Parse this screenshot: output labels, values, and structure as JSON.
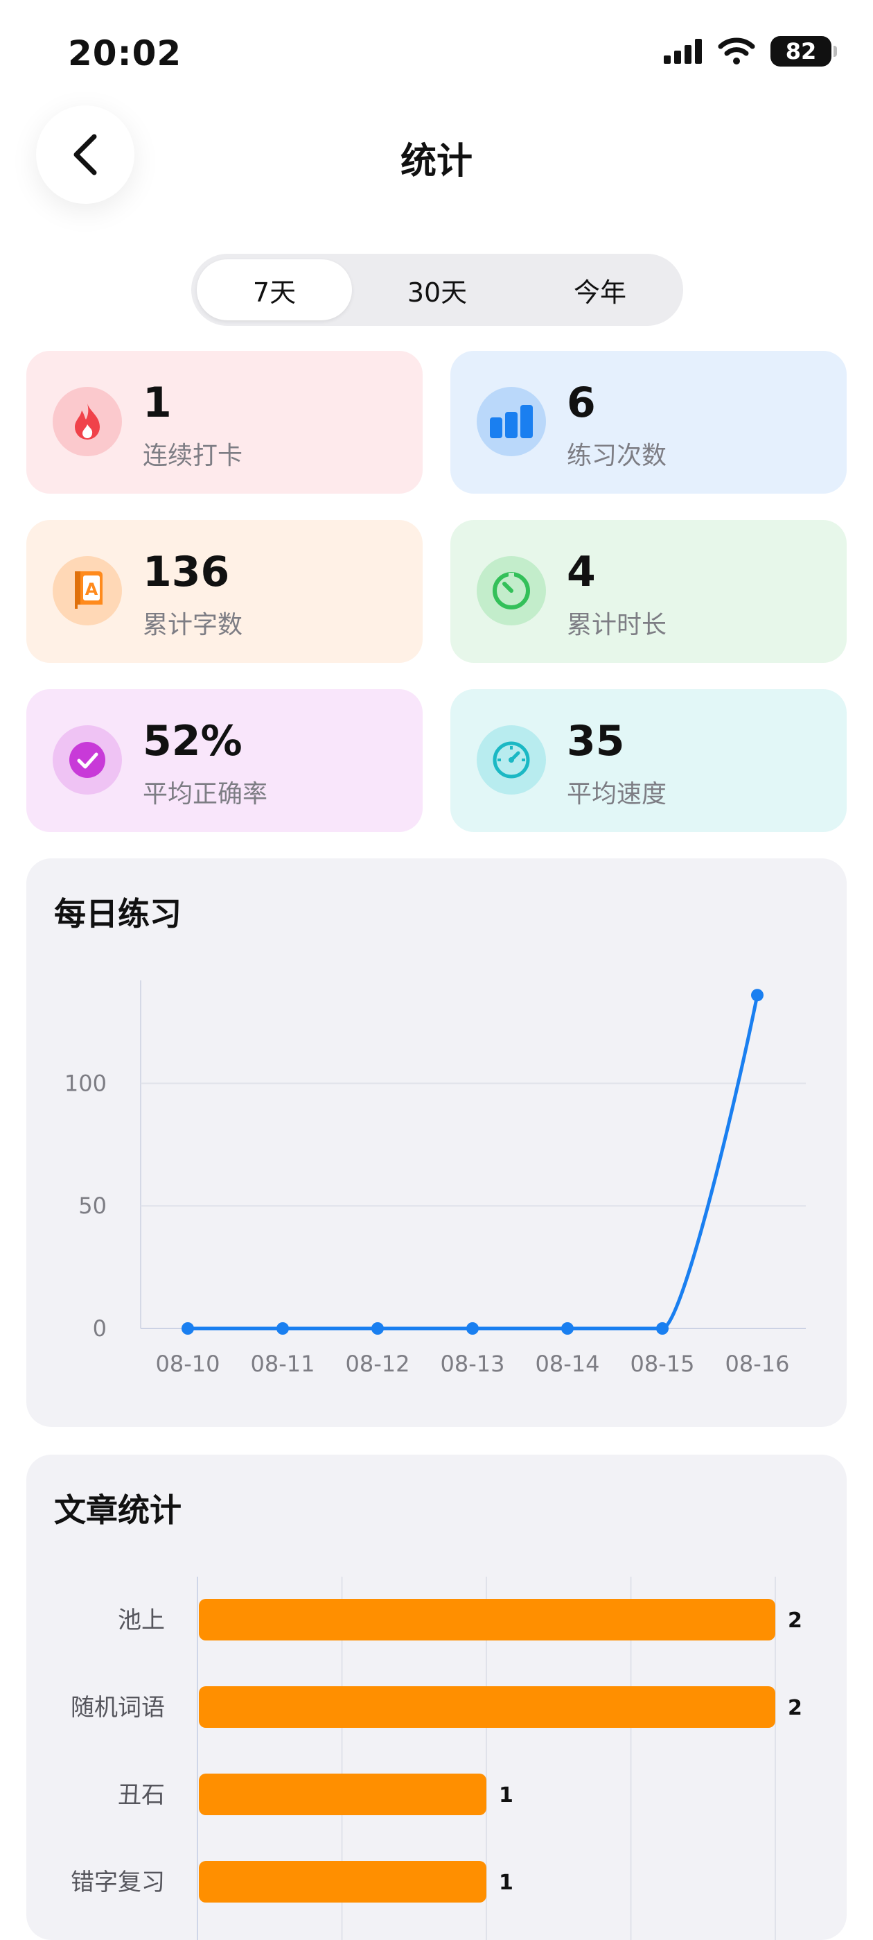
{
  "status_bar": {
    "time": "20:02",
    "battery": "82"
  },
  "nav": {
    "title": "统计"
  },
  "tabs": [
    {
      "label": "7天",
      "active": true
    },
    {
      "label": "30天",
      "active": false
    },
    {
      "label": "今年",
      "active": false
    }
  ],
  "stats": [
    {
      "value": "1",
      "label": "连续打卡",
      "icon": "flame-icon",
      "color": "#f0424a"
    },
    {
      "value": "6",
      "label": "练习次数",
      "icon": "bar-chart-icon",
      "color": "#1a7ff0"
    },
    {
      "value": "136",
      "label": "累计字数",
      "icon": "book-icon",
      "color": "#ff8a1c"
    },
    {
      "value": "4",
      "label": "累计时长",
      "icon": "timer-icon",
      "color": "#33c059"
    },
    {
      "value": "52%",
      "label": "平均正确率",
      "icon": "check-icon",
      "color": "#c83ad8"
    },
    {
      "value": "35",
      "label": "平均速度",
      "icon": "speedometer-icon",
      "color": "#1bb8c4"
    }
  ],
  "daily": {
    "title": "每日练习",
    "chart_data": {
      "type": "line",
      "categories": [
        "08-10",
        "08-11",
        "08-12",
        "08-13",
        "08-14",
        "08-15",
        "08-16"
      ],
      "values": [
        0,
        0,
        0,
        0,
        0,
        0,
        136
      ],
      "yticks": [
        0,
        50,
        100
      ],
      "ylim": [
        0,
        142
      ],
      "color": "#1a7ff0",
      "grid": true
    }
  },
  "articles": {
    "title": "文章统计",
    "chart_data": {
      "type": "bar",
      "orientation": "horizontal",
      "categories": [
        "池上",
        "随机词语",
        "丑石",
        "错字复习"
      ],
      "values": [
        2,
        2,
        1,
        1
      ],
      "xlim": [
        0,
        2
      ],
      "color": "#ff8f00",
      "grid": true
    }
  }
}
